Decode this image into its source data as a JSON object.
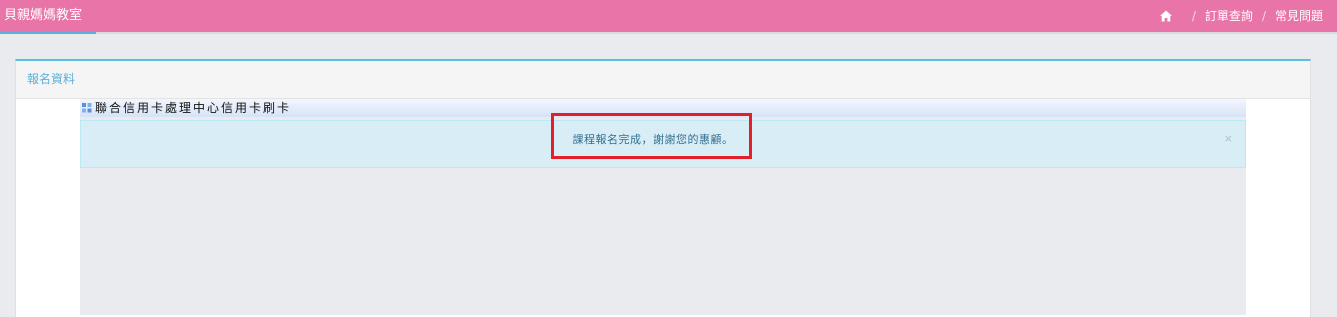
{
  "app": {
    "brand": "貝親媽媽教室"
  },
  "nav": {
    "home_icon": "home-icon",
    "sep1": "/",
    "orders": "訂單查詢",
    "sep2": "/",
    "faq": "常見問題"
  },
  "panel": {
    "title": "報名資料"
  },
  "frame": {
    "title": "聯合信用卡處理中心信用卡刷卡",
    "icon": "grid-icon"
  },
  "alert": {
    "message": "課程報名完成，謝謝您的惠顧。",
    "close": "×"
  },
  "colors": {
    "topbar": "#e874a8",
    "accent": "#5bc0de",
    "alert_bg": "#d9edf7",
    "highlight": "#e3202a"
  }
}
